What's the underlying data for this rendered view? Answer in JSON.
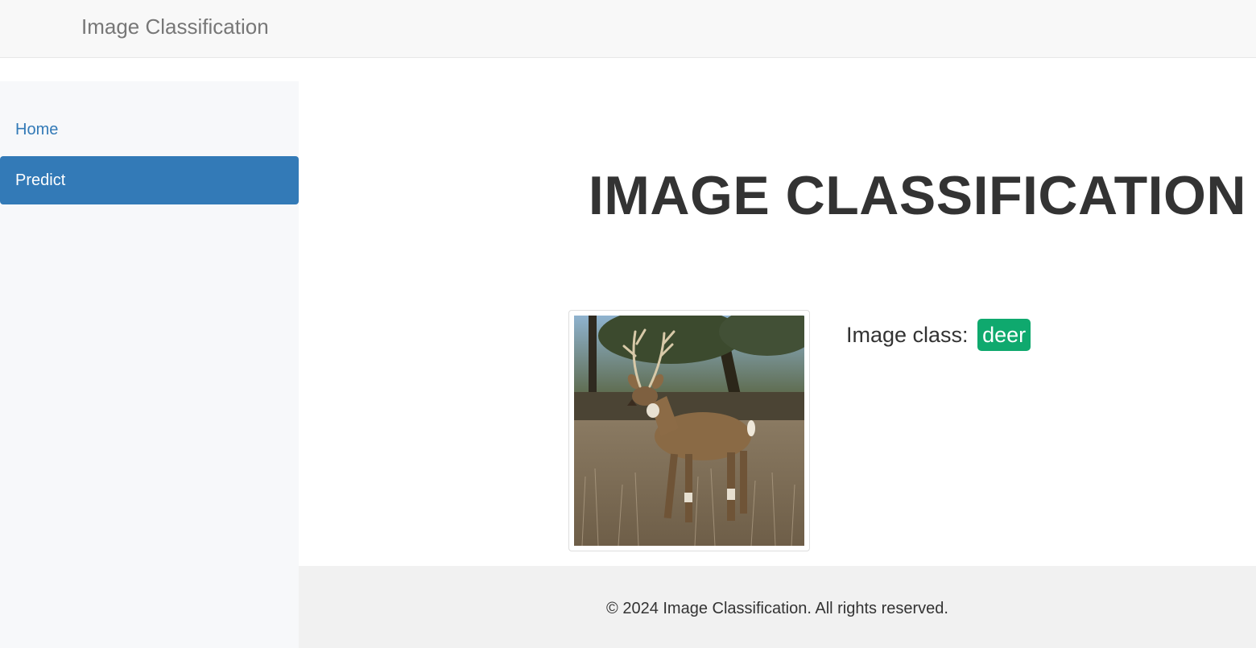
{
  "navbar": {
    "brand": "Image Classification"
  },
  "sidebar": {
    "items": [
      {
        "label": "Home",
        "active": false
      },
      {
        "label": "Predict",
        "active": true
      }
    ]
  },
  "main": {
    "title": "IMAGE CLASSIFICATION",
    "image_subject": "deer photo",
    "result_label": "Image class:",
    "result_class": "deer",
    "badge_color": "#0fa96e"
  },
  "footer": {
    "text": "© 2024 Image Classification. All rights reserved."
  },
  "colors": {
    "accent": "#337ab7",
    "navbar_bg": "#f8f8f8",
    "sidebar_bg": "#f7f8fa",
    "footer_bg": "#f1f1f1"
  }
}
